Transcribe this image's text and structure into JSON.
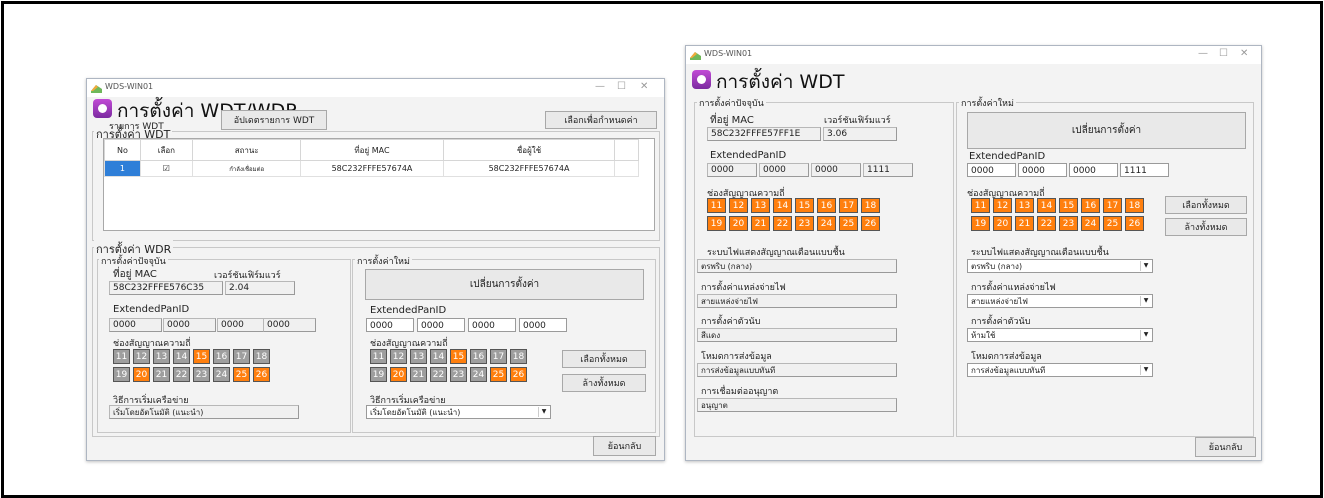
{
  "window_title": "WDS-WIN01",
  "controls": {
    "minimize": "—",
    "maximize": "☐",
    "close": "✕"
  },
  "left": {
    "header": "การตั้งค่า WDT/WDR",
    "wdt_group": "การตั้งค่า WDT",
    "wdt_list_label": "รายการ WDT",
    "update_button": "อัปเดตรายการ WDT",
    "select_button": "เลือกเพื่อกำหนดค่า",
    "table_headers": [
      "No",
      "เลือก",
      "สถานะ",
      "ที่อยู่ MAC",
      "ชื่อผู้ใช้"
    ],
    "table_rows": [
      {
        "no": "1",
        "checked": "☑",
        "status": "กำลังเชื่อมต่อ",
        "mac": "58C232FFFE57674A",
        "user": "58C232FFFE57674A"
      }
    ],
    "wdr_group": "การตั้งค่า WDR",
    "current": {
      "group": "การตั้งค่าปัจจุบัน",
      "mac_label": "ที่อยู่ MAC",
      "fw_label": "เวอร์ชันเฟิร์มแวร์",
      "mac": "58C232FFFE576C35",
      "fw": "2.04",
      "epid_label": "ExtendedPanID",
      "epid": [
        "0000",
        "0000",
        "0000",
        "0000"
      ],
      "channel_label": "ช่องสัญญาณความถี่",
      "channels_on": [
        "15",
        "20",
        "25",
        "26"
      ],
      "method_label": "วิธีการเริ่มเครือข่าย",
      "method": "เริ่มโดยอัตโนมัติ (แนะนำ)"
    },
    "new": {
      "group": "การตั้งค่าใหม่",
      "change_button": "เปลี่ยนการตั้งค่า",
      "epid_label": "ExtendedPanID",
      "epid": [
        "0000",
        "0000",
        "0000",
        "0000"
      ],
      "channel_label": "ช่องสัญญาณความถี่",
      "channels_on": [
        "15",
        "20",
        "25",
        "26"
      ],
      "select_all": "เลือกทั้งหมด",
      "clear_all": "ล้างทั้งหมด",
      "method_label": "วิธีการเริ่มเครือข่าย",
      "method": "เริ่มโดยอัตโนมัติ (แนะนำ)"
    },
    "back_button": "ย้อนกลับ"
  },
  "right": {
    "header": "การตั้งค่า WDT",
    "current": {
      "group": "การตั้งค่าปัจจุบัน",
      "mac_label": "ที่อยู่ MAC",
      "fw_label": "เวอร์ชันเฟิร์มแวร์",
      "mac": "58C232FFFE57FF1E",
      "fw": "3.06",
      "epid_label": "ExtendedPanID",
      "epid": [
        "0000",
        "0000",
        "0000",
        "1111"
      ],
      "channel_label": "ช่องสัญญาณความถี่",
      "led_label": "ระบบไฟแสดงสัญญาณเตือนแบบชื้น",
      "led": "ตรพริบ (กลาง)",
      "power_label": "การตั้งค่าแหล่งจ่ายไฟ",
      "power": "สายแหล่งจ่ายไฟ",
      "counter_label": "การตั้งค่าตัวนับ",
      "counter": "สีแดง",
      "send_label": "โหมดการส่งข้อมูล",
      "send": "การส่งข้อมูลแบบทันที",
      "conn_label": "การเชื่อมต่ออนุญาต",
      "conn": "อนุญาต"
    },
    "new": {
      "group": "การตั้งค่าใหม่",
      "change_button": "เปลี่ยนการตั้งค่า",
      "epid_label": "ExtendedPanID",
      "epid": [
        "0000",
        "0000",
        "0000",
        "1111"
      ],
      "channel_label": "ช่องสัญญาณความถี่",
      "select_all": "เลือกทั้งหมด",
      "clear_all": "ล้างทั้งหมด",
      "led_label": "ระบบไฟแสดงสัญญาณเตือนแบบชื้น",
      "led": "ตรพริบ (กลาง)",
      "power_label": "การตั้งค่าแหล่งจ่ายไฟ",
      "power": "สายแหล่งจ่ายไฟ",
      "counter_label": "การตั้งค่าตัวนับ",
      "counter": "ห้ามใช้",
      "send_label": "โหมดการส่งข้อมูล",
      "send": "การส่งข้อมูลแบบทันที"
    },
    "back_button": "ย้อนกลับ"
  },
  "channels": [
    "11",
    "12",
    "13",
    "14",
    "15",
    "16",
    "17",
    "18",
    "19",
    "20",
    "21",
    "22",
    "23",
    "24",
    "25",
    "26"
  ],
  "colors": {
    "channel_on": "#ff7f0e",
    "channel_off": "#9e9e9e",
    "selection": "#2f7fd8",
    "header_icon": "#9b3bbf"
  }
}
